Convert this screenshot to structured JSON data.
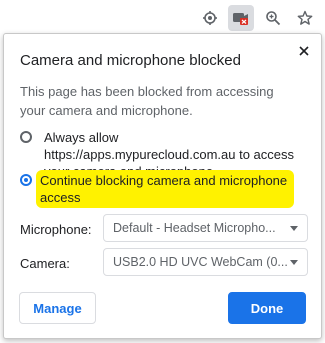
{
  "toolbar": {
    "icons": [
      "location-icon",
      "camera-blocked-icon",
      "zoom-icon",
      "star-icon"
    ]
  },
  "dialog": {
    "title": "Camera and microphone blocked",
    "description": "This page has been blocked from accessing your camera and microphone.",
    "options": [
      {
        "label": "Always allow https://apps.mypurecloud.com.au to access your camera and microphone",
        "selected": false
      },
      {
        "label": "Continue blocking camera and microphone access",
        "selected": true
      }
    ],
    "microphone": {
      "label": "Microphone:",
      "value": "Default - Headset Micropho..."
    },
    "camera": {
      "label": "Camera:",
      "value": "USB2.0 HD UVC WebCam (0..."
    },
    "manage_label": "Manage",
    "done_label": "Done"
  },
  "colors": {
    "accent": "#1a73e8",
    "highlight": "#fff200",
    "blocked_badge": "#d93025"
  }
}
